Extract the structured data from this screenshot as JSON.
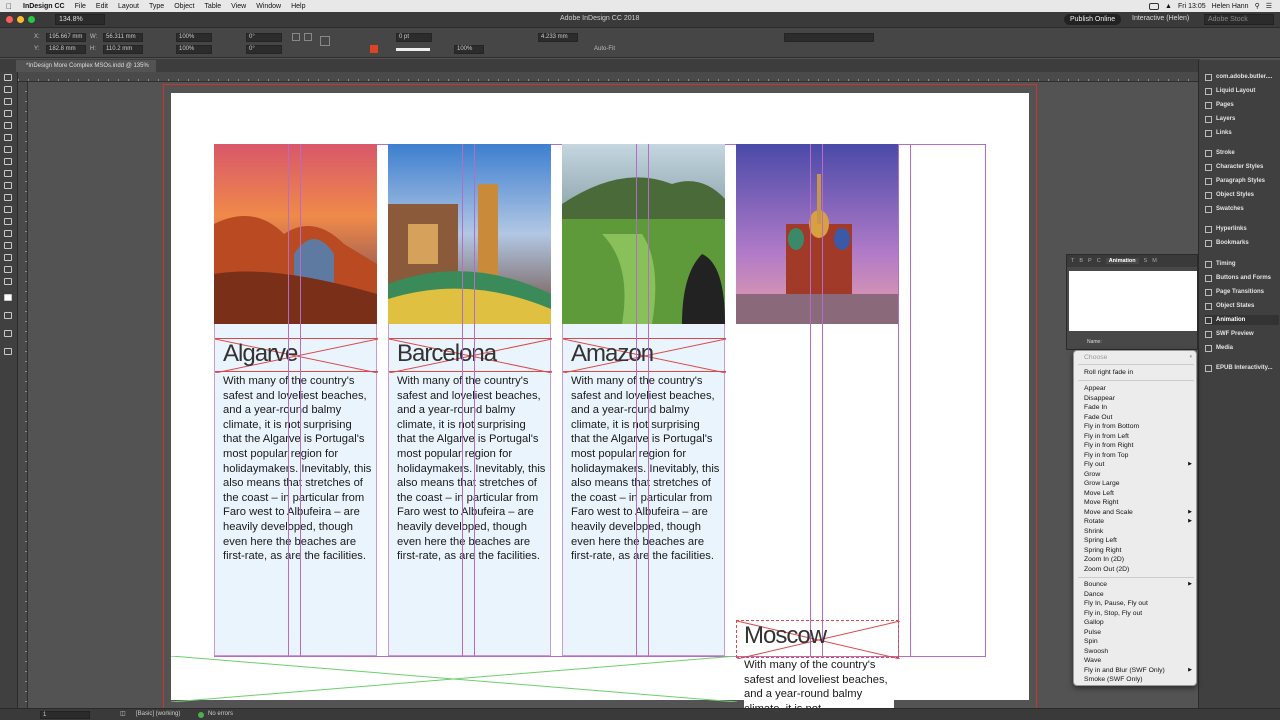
{
  "menubar": {
    "app_name": "InDesign CC",
    "items": [
      "File",
      "Edit",
      "Layout",
      "Type",
      "Object",
      "Table",
      "View",
      "Window",
      "Help"
    ],
    "clock": "Fri 13:05",
    "user": "Helen Hann"
  },
  "appbar": {
    "zoom": "134.8%",
    "title": "Adobe InDesign CC 2018",
    "publish": "Publish Online",
    "workspace": "Interactive (Helen)",
    "stock_placeholder": "Adobe Stock"
  },
  "controlbar": {
    "x_label": "X:",
    "x_value": "195.667 mm",
    "y_label": "Y:",
    "y_value": "182.8 mm",
    "w_label": "W:",
    "w_value": "56.311 mm",
    "h_label": "H:",
    "h_value": "110.2 mm",
    "scale_x": "100%",
    "scale_y": "100%",
    "rotate": "0°",
    "shear": "0°",
    "stroke_weight": "0 pt",
    "opacity": "100%",
    "gap": "4.233 mm",
    "autofit": "Auto-Fit"
  },
  "doc_tab": "*InDesign More Complex MSOs.indd @ 135%",
  "cards": [
    {
      "title": "Algarve",
      "body": "With many of the country's safest and loveliest beaches, and a year-round balmy climate, it is not surprising that the Algarve is Portugal's most popular region for holidaymakers. Inevitably, this also means that stretches of the coast – in particular from Faro west to Albufeira – are heavily developed, though even here the beaches are first-rate, as are the facilities."
    },
    {
      "title": "Barcelona",
      "body": "With many of the country's safest and loveliest beaches, and a year-round balmy climate, it is not surprising that the Algarve is Portugal's most popular region for holidaymakers. Inevitably, this also means that stretches of the coast – in particular from Faro west to Albufeira – are heavily developed, though even here the beaches are first-rate, as are the facilities."
    },
    {
      "title": "Amazon",
      "body": "With many of the country's safest and loveliest beaches, and a year-round balmy climate, it is not surprising that the Algarve is Portugal's most popular region for holidaymakers. Inevitably, this also means that stretches of the coast – in particular from Faro west to Albufeira – are heavily developed, though even here the beaches are first-rate, as are the facilities."
    }
  ],
  "moscow": {
    "title": "Moscow",
    "body": "With many of the country's safest and loveliest beaches, and a year-round balmy climate, it is not"
  },
  "dock": [
    "com.adobe.butler....",
    "Liquid Layout",
    "Pages",
    "Layers",
    "Links",
    "Stroke",
    "Character Styles",
    "Paragraph Styles",
    "Object Styles",
    "Swatches",
    "Hyperlinks",
    "Bookmarks",
    "Timing",
    "Buttons and Forms",
    "Page Transitions",
    "Object States",
    "Animation",
    "SWF Preview",
    "Media",
    "EPUB Interactivity..."
  ],
  "animpanel": {
    "tabs": [
      "T",
      "B",
      "P",
      "C",
      "Animation",
      "S",
      "M"
    ],
    "name_label": "Name:"
  },
  "dropdown": {
    "header": "Choose",
    "recent": "Roll right fade in",
    "group1": [
      {
        "label": "Appear"
      },
      {
        "label": "Disappear"
      },
      {
        "label": "Fade In"
      },
      {
        "label": "Fade Out"
      },
      {
        "label": "Fly in from Bottom"
      },
      {
        "label": "Fly in from Left"
      },
      {
        "label": "Fly in from Right"
      },
      {
        "label": "Fly in from Top"
      },
      {
        "label": "Fly out",
        "submenu": true
      },
      {
        "label": "Grow"
      },
      {
        "label": "Grow Large"
      },
      {
        "label": "Move Left"
      },
      {
        "label": "Move Right"
      },
      {
        "label": "Move and Scale",
        "submenu": true
      },
      {
        "label": "Rotate",
        "submenu": true
      },
      {
        "label": "Shrink"
      },
      {
        "label": "Spring Left"
      },
      {
        "label": "Spring Right"
      },
      {
        "label": "Zoom In (2D)"
      },
      {
        "label": "Zoom Out (2D)"
      }
    ],
    "group2": [
      {
        "label": "Bounce",
        "submenu": true
      },
      {
        "label": "Dance"
      },
      {
        "label": "Fly In, Pause, Fly out"
      },
      {
        "label": "Fly in, Stop, Fly out"
      },
      {
        "label": "Gallop"
      },
      {
        "label": "Pulse"
      },
      {
        "label": "Spin"
      },
      {
        "label": "Swoosh"
      },
      {
        "label": "Wave"
      },
      {
        "label": "Fly in and Blur (SWF Only)",
        "submenu": true
      },
      {
        "label": "Smoke (SWF Only)"
      }
    ]
  },
  "statusbar": {
    "page": "1",
    "style": "[Basic] (working)",
    "errors": "No errors"
  }
}
